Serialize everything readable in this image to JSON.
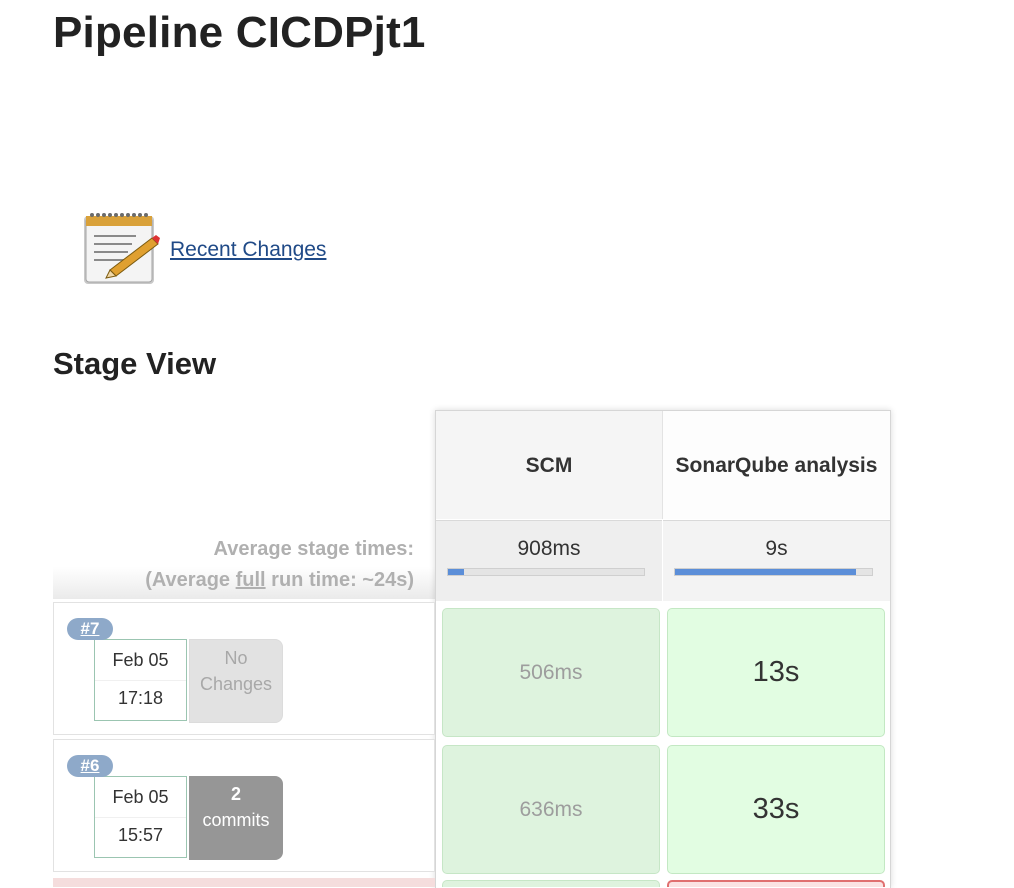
{
  "page": {
    "title": "Pipeline CICDPjt1"
  },
  "recent_changes": {
    "label": "Recent Changes",
    "icon": "notepad-pencil-icon"
  },
  "stage_view": {
    "heading": "Stage View",
    "average_label_line1": "Average stage times:",
    "average_label_prefix": "(Average ",
    "average_label_full": "full",
    "average_label_suffix": " run time: ~24s)",
    "stages": [
      {
        "name": "SCM",
        "avg_time": "908ms",
        "avg_fraction": 0.08
      },
      {
        "name": "SonarQube analysis",
        "avg_time": "9s",
        "avg_fraction": 0.92
      }
    ],
    "runs": [
      {
        "number": "#7",
        "date": "Feb 05",
        "time": "17:18",
        "changes": {
          "type": "none",
          "line1": "No",
          "line2": "Changes"
        },
        "stage_times": [
          "506ms",
          "13s"
        ]
      },
      {
        "number": "#6",
        "date": "Feb 05",
        "time": "15:57",
        "changes": {
          "type": "commits",
          "line1": "2",
          "line2": "commits"
        },
        "stage_times": [
          "636ms",
          "33s"
        ]
      }
    ]
  },
  "colors": {
    "success_cell": "#def3de",
    "failed_cell": "#fbe3e3",
    "progress_bar": "#5b8ed8",
    "link": "#204a87",
    "badge": "#8ea9c9"
  }
}
